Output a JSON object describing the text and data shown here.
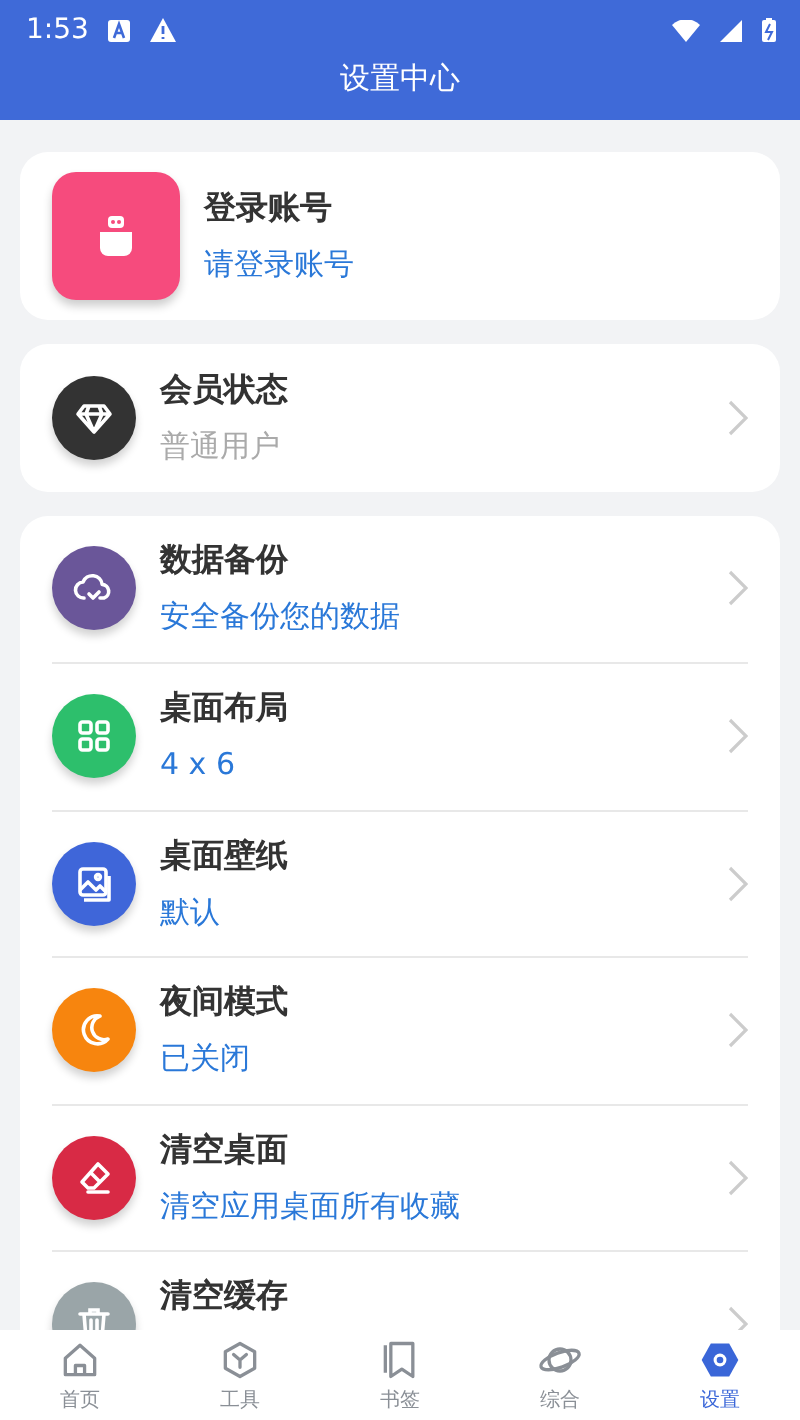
{
  "status_bar": {
    "time": "1:53"
  },
  "header": {
    "title": "设置中心"
  },
  "login": {
    "title": "登录账号",
    "subtitle": "请登录账号"
  },
  "member": {
    "title": "会员状态",
    "subtitle": "普通用户",
    "color": "#333333"
  },
  "settings": [
    {
      "title": "数据备份",
      "subtitle": "安全备份您的数据",
      "color": "#6a5699"
    },
    {
      "title": "桌面布局",
      "subtitle": "4 x 6",
      "color": "#2dbf6c"
    },
    {
      "title": "桌面壁纸",
      "subtitle": "默认",
      "color": "#3f66d9"
    },
    {
      "title": "夜间模式",
      "subtitle": "已关闭",
      "color": "#f7850e"
    },
    {
      "title": "清空桌面",
      "subtitle": "清空应用桌面所有收藏",
      "color": "#d82a45"
    },
    {
      "title": "清空缓存",
      "color": "#9aa5a8"
    }
  ],
  "bottom_nav": [
    {
      "label": "首页",
      "selected": false
    },
    {
      "label": "工具",
      "selected": false
    },
    {
      "label": "书签",
      "selected": false
    },
    {
      "label": "综合",
      "selected": false
    },
    {
      "label": "设置",
      "selected": true
    }
  ]
}
